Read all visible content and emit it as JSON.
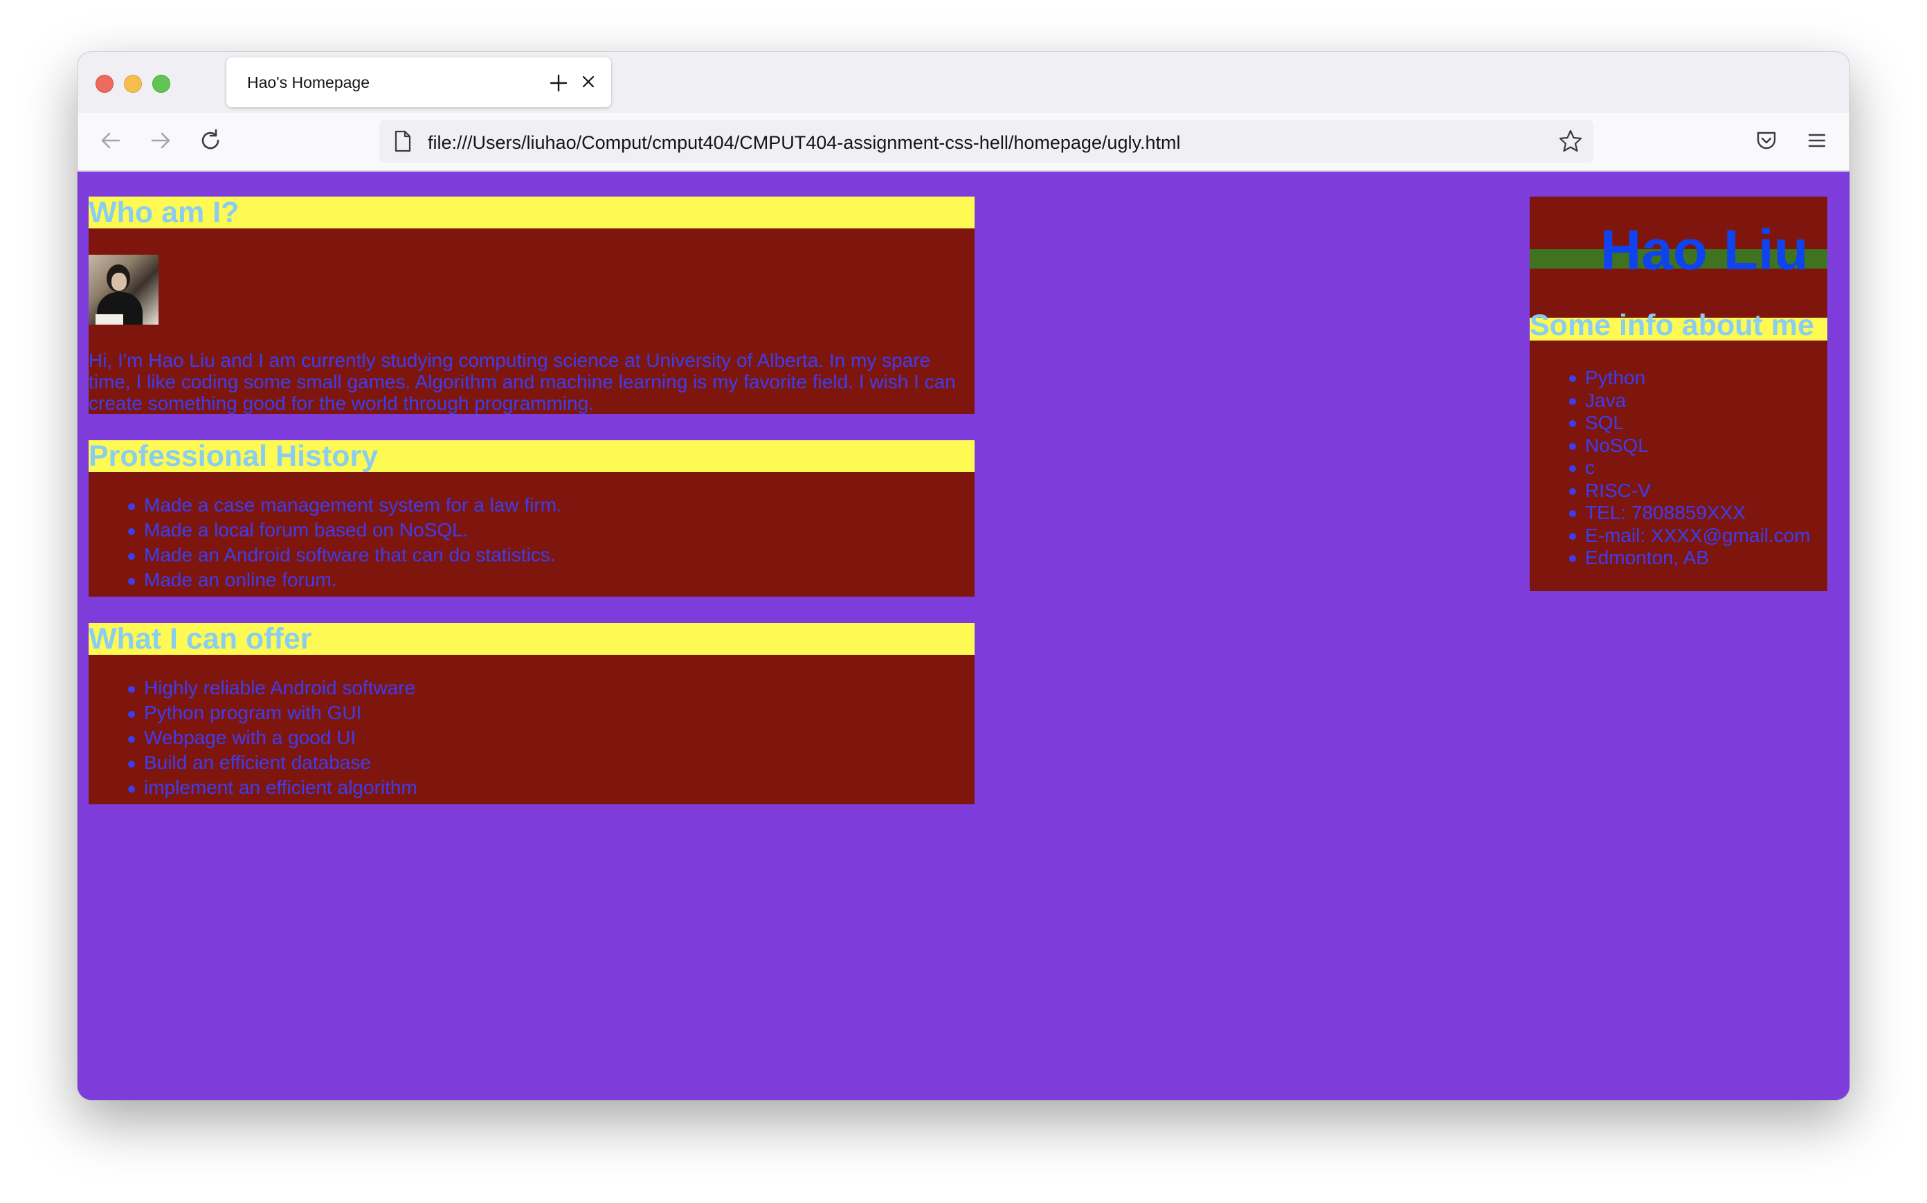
{
  "browser": {
    "tab_title": "Hao's Homepage",
    "url": "file:///Users/liuhao/Comput/cmput404/CMPUT404-assignment-css-hell/homepage/ugly.html"
  },
  "page": {
    "about": {
      "heading": "Who am I?",
      "text": "Hi, I'm Hao Liu and I am currently studying computing science at University of Alberta. In my spare time, I like coding some small games. Algorithm and machine learning is my favorite field. I wish I can create something good for the world through programming."
    },
    "history": {
      "heading": "Professional History",
      "items": [
        "Made a case management system for a law firm.",
        "Made a local forum based on NoSQL.",
        "Made an Android software that can do statistics.",
        "Made an online forum."
      ]
    },
    "offer": {
      "heading": "What I can offer",
      "items": [
        "Highly reliable Android software",
        "Python program with GUI",
        "Webpage with a good UI",
        "Build an efficient database",
        "implement an efficient algorithm"
      ]
    },
    "sidebar": {
      "name": "Hao Liu",
      "info_heading": "Some info about me",
      "items": [
        "Python",
        "Java",
        "SQL",
        "NoSQL",
        "c",
        "RISC-V",
        "TEL: 7808859XXX",
        "E-mail: XXXX@gmail.com",
        "Edmonton, AB"
      ]
    }
  },
  "colors": {
    "page_bg": "#7e3ddb",
    "section_bg": "#7f160e",
    "heading_bg": "#fefa53",
    "heading_text": "#89cdf1",
    "body_text": "#3d3df0",
    "name_text": "#0e43ee",
    "name_stripe": "#3f7320"
  }
}
